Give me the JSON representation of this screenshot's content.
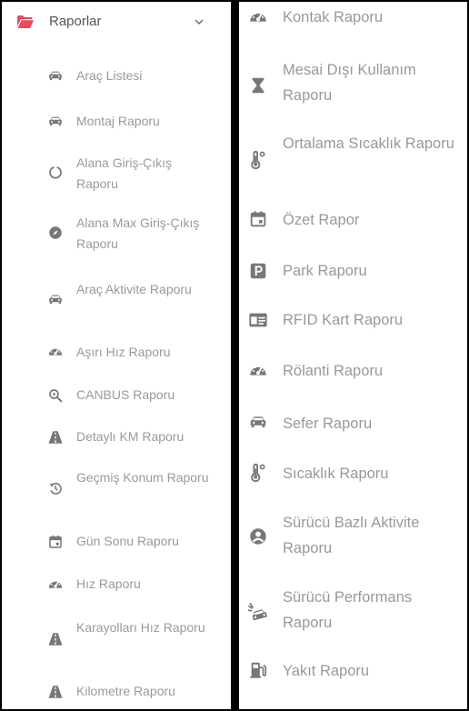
{
  "left": {
    "header": {
      "title": "Raporlar",
      "icon": "folder-open-icon",
      "chevron": "chevron-down-icon",
      "accent": "#e84a5f"
    },
    "items": [
      {
        "label": "Araç Listesi",
        "icon": "car-icon"
      },
      {
        "label": "Montaj Raporu",
        "icon": "car-icon"
      },
      {
        "label": "Alana Giriş-Çıkış Raporu",
        "icon": "circle-notch-icon"
      },
      {
        "label": "Alana Max Giriş-Çıkış Raporu",
        "icon": "compass-icon"
      },
      {
        "label": "Araç Aktivite Raporu",
        "icon": "car-icon"
      },
      {
        "label": "Aşırı Hız Raporu",
        "icon": "speedometer-icon"
      },
      {
        "label": "CANBUS Raporu",
        "icon": "zoom-search-icon"
      },
      {
        "label": "Detaylı KM Raporu",
        "icon": "road-icon"
      },
      {
        "label": "Geçmiş Konum Raporu",
        "icon": "history-icon"
      },
      {
        "label": "Gün Sonu Raporu",
        "icon": "calendar-icon"
      },
      {
        "label": "Hız Raporu",
        "icon": "speedometer-icon"
      },
      {
        "label": "Karayolları Hız Raporu",
        "icon": "road-icon"
      },
      {
        "label": "Kilometre Raporu",
        "icon": "road-icon"
      }
    ]
  },
  "right": {
    "items": [
      {
        "label": "Kontak Raporu",
        "icon": "speedometer-icon"
      },
      {
        "label": "Mesai Dışı Kullanım Raporu",
        "icon": "hourglass-icon"
      },
      {
        "label": "Ortalama Sıcaklık Raporu",
        "icon": "thermometer-icon"
      },
      {
        "label": "Özet Rapor",
        "icon": "calendar-icon"
      },
      {
        "label": "Park Raporu",
        "icon": "parking-icon"
      },
      {
        "label": "RFID Kart Raporu",
        "icon": "id-card-icon"
      },
      {
        "label": "Rölanti Raporu",
        "icon": "speedometer-icon"
      },
      {
        "label": "Sefer Raporu",
        "icon": "car-icon"
      },
      {
        "label": "Sıcaklık Raporu",
        "icon": "thermometer-icon"
      },
      {
        "label": "Sürücü Bazlı Aktivite Raporu",
        "icon": "user-circle-icon"
      },
      {
        "label": "Sürücü Performans Raporu",
        "icon": "car-crash-icon"
      },
      {
        "label": "Yakıt Raporu",
        "icon": "fuel-icon"
      }
    ]
  }
}
